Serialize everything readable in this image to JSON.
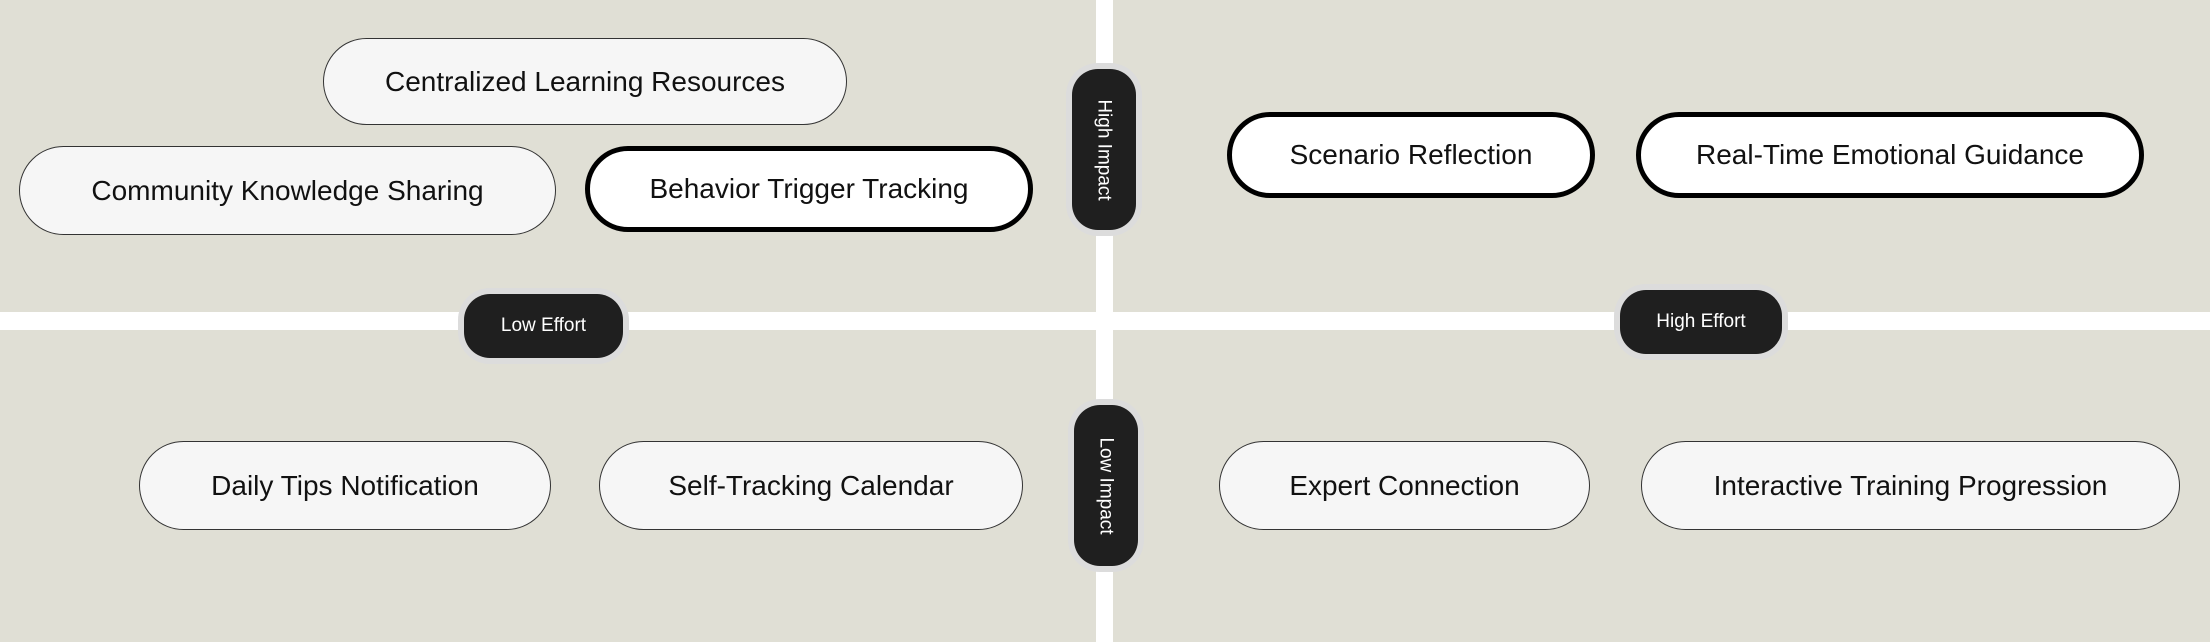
{
  "diagram": {
    "type": "impact-effort-matrix",
    "axes": {
      "high_impact": "High Impact",
      "low_impact": "Low Impact",
      "low_effort": "Low Effort",
      "high_effort": "High Effort"
    },
    "quadrants": {
      "high_impact_low_effort": [
        {
          "label": "Centralized Learning Resources",
          "highlighted": false
        },
        {
          "label": "Community Knowledge Sharing",
          "highlighted": false
        },
        {
          "label": "Behavior Trigger Tracking",
          "highlighted": true
        }
      ],
      "high_impact_high_effort": [
        {
          "label": "Scenario Reflection",
          "highlighted": true
        },
        {
          "label": "Real-Time Emotional Guidance",
          "highlighted": true
        }
      ],
      "low_impact_low_effort": [
        {
          "label": "Daily Tips Notification",
          "highlighted": false
        },
        {
          "label": "Self-Tracking Calendar",
          "highlighted": false
        }
      ],
      "low_impact_high_effort": [
        {
          "label": "Expert Connection",
          "highlighted": false
        },
        {
          "label": "Interactive Training Progression",
          "highlighted": false
        }
      ]
    },
    "colors": {
      "background": "#e0dfd5",
      "divider": "#ffffff",
      "axis_pill": "#1f1f1f",
      "item_fill": "#f6f6f6",
      "highlight_border": "#000000"
    }
  }
}
